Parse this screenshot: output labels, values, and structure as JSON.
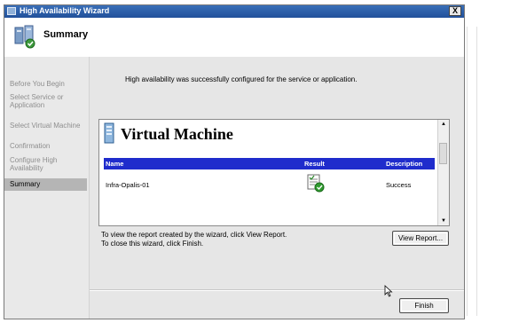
{
  "window": {
    "title": "High Availability Wizard",
    "close_label": "X"
  },
  "header": {
    "title": "Summary"
  },
  "sidebar": {
    "steps": [
      {
        "label": "Before You Begin"
      },
      {
        "label": "Select Service or Application"
      },
      {
        "label": "Select Virtual Machine"
      },
      {
        "label": "Confirmation"
      },
      {
        "label": "Configure High Availability"
      },
      {
        "label": "Summary"
      }
    ]
  },
  "main": {
    "message": "High availability was successfully configured for the service or application.",
    "report": {
      "title": "Virtual Machine",
      "columns": [
        "Name",
        "Result",
        "Description"
      ],
      "rows": [
        {
          "name": "Infra-Opalis-01",
          "result_icon": "success-report-icon",
          "description": "Success"
        }
      ]
    },
    "help_line1": "To view the report created by the wizard, click View Report.",
    "help_line2": "To close this wizard, click Finish.",
    "view_report_label": "View Report...",
    "finish_label": "Finish"
  },
  "colors": {
    "titlebar": "#21509a",
    "table_header": "#1f2ccc",
    "active_step": "#b5b5b5"
  }
}
